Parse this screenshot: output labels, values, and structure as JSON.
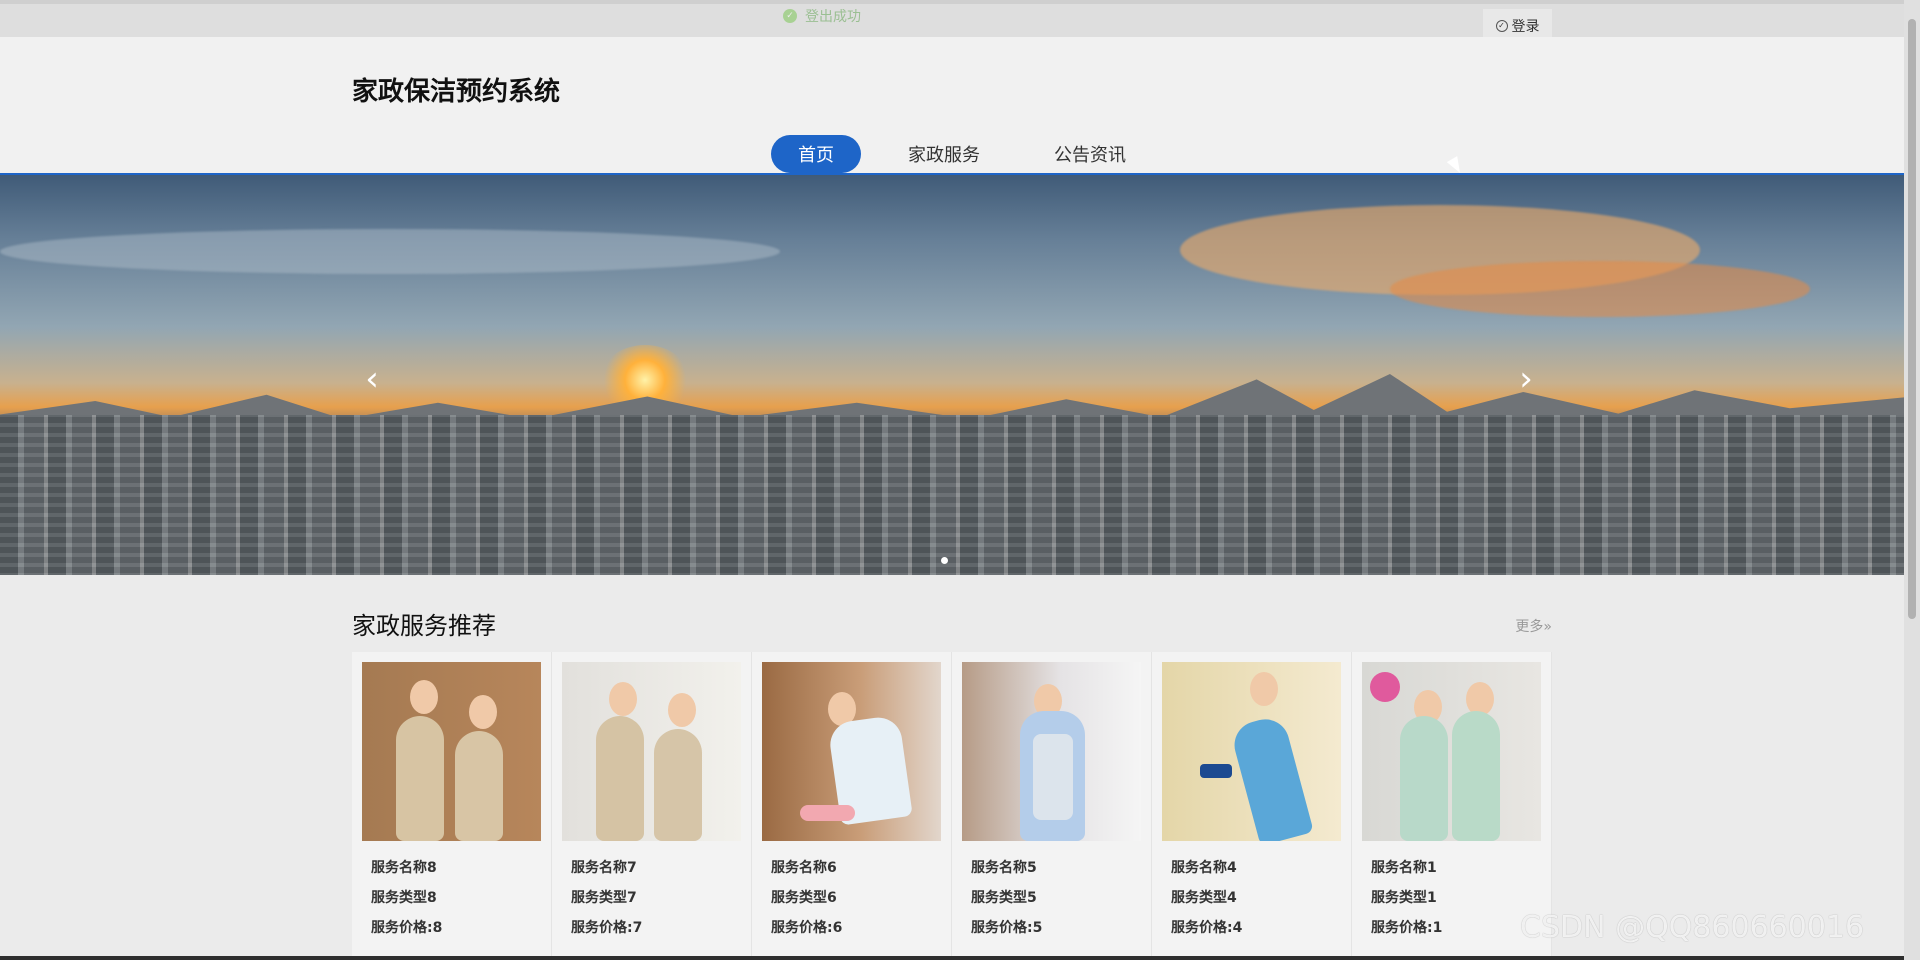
{
  "app": {
    "title": "家政保洁预约系统",
    "toast": "登出成功",
    "login": "登录"
  },
  "nav": {
    "items": [
      {
        "label": "首页",
        "active": true
      },
      {
        "label": "家政服务",
        "active": false
      },
      {
        "label": "公告资讯",
        "active": false
      }
    ]
  },
  "carousel": {
    "prev_icon": "chevron-left-icon",
    "next_icon": "chevron-right-icon",
    "dots": [
      true
    ]
  },
  "section": {
    "title": "家政服务推荐",
    "more": "更多»"
  },
  "services": [
    {
      "name": "服务名称8",
      "type": "服务类型8",
      "price": "服务价格:8"
    },
    {
      "name": "服务名称7",
      "type": "服务类型7",
      "price": "服务价格:7"
    },
    {
      "name": "服务名称6",
      "type": "服务类型6",
      "price": "服务价格:6"
    },
    {
      "name": "服务名称5",
      "type": "服务类型5",
      "price": "服务价格:5"
    },
    {
      "name": "服务名称4",
      "type": "服务类型4",
      "price": "服务价格:4"
    },
    {
      "name": "服务名称1",
      "type": "服务类型1",
      "price": "服务价格:1"
    }
  ],
  "watermark": "CSDN @QQ860660016",
  "colors": {
    "primary": "#1e65c8",
    "success": "#67c23a"
  }
}
